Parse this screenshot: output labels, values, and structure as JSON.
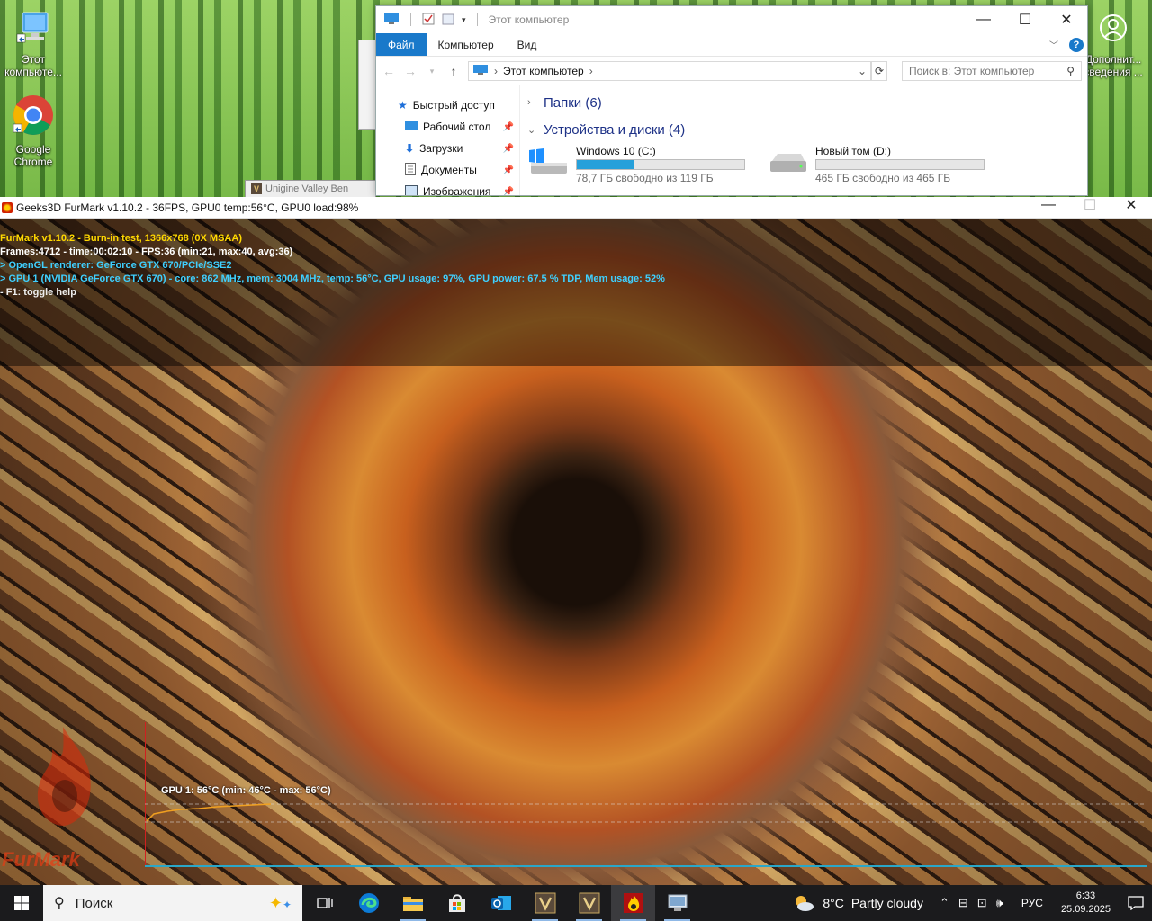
{
  "desktop": {
    "icons": [
      {
        "label": "Этот компьюте...",
        "icon": "computer-icon"
      },
      {
        "label": "Google Chrome",
        "icon": "chrome-icon"
      },
      {
        "label": "Дополнит... сведения ...",
        "icon": "user-icon"
      }
    ]
  },
  "behind_window": {
    "title": "Unigine Valley Ben"
  },
  "explorer": {
    "title": "Этот компьютер",
    "tabs": [
      "Файл",
      "Компьютер",
      "Вид"
    ],
    "active_tab": "Файл",
    "address": "Этот компьютер",
    "search_placeholder": "Поиск в: Этот компьютер",
    "nav": [
      {
        "label": "Быстрый доступ",
        "icon": "star-icon"
      },
      {
        "label": "Рабочий стол",
        "icon": "desktop-icon",
        "pinned": true
      },
      {
        "label": "Загрузки",
        "icon": "download-icon",
        "pinned": true
      },
      {
        "label": "Документы",
        "icon": "document-icon",
        "pinned": true
      },
      {
        "label": "Изображения",
        "icon": "image-icon",
        "pinned": true
      }
    ],
    "groups": [
      {
        "label": "Папки (6)",
        "expanded": false
      },
      {
        "label": "Устройства и диски (4)",
        "expanded": true
      }
    ],
    "drives": [
      {
        "name": "Windows 10 (C:)",
        "free": "78,7 ГБ свободно из 119 ГБ",
        "used_fraction": 0.34
      },
      {
        "name": "Новый том (D:)",
        "free": "465 ГБ свободно из 465 ГБ",
        "used_fraction": 0.0
      }
    ]
  },
  "furmark": {
    "title": "Geeks3D FurMark v1.10.2 - 36FPS, GPU0 temp:56°C, GPU0 load:98%",
    "hud": {
      "line1": "FurMark v1.10.2 - Burn-in test, 1366x768 (0X MSAA)",
      "line2": "Frames:4712 - time:00:02:10 - FPS:36 (min:21, max:40, avg:36)",
      "line3": "> OpenGL renderer: GeForce GTX 670/PCIe/SSE2",
      "line4": "> GPU 1 (NVIDIA GeForce GTX 670) - core: 862 MHz, mem: 3004 MHz, temp: 56°C, GPU usage: 97%, GPU power: 67.5 % TDP, Mem usage: 52%",
      "line5": "- F1: toggle help"
    },
    "graph_label": "GPU 1: 56°C (min: 46°C - max: 56°C)",
    "logo_text": "FurMark"
  },
  "taskbar": {
    "search_placeholder": "Поиск",
    "apps": [
      {
        "name": "task-view",
        "icon": "task-view-icon"
      },
      {
        "name": "edge",
        "icon": "edge-icon"
      },
      {
        "name": "file-explorer",
        "icon": "folder-icon",
        "open": true
      },
      {
        "name": "store",
        "icon": "store-icon"
      },
      {
        "name": "outlook",
        "icon": "outlook-icon"
      },
      {
        "name": "valley-1",
        "icon": "valley-icon",
        "open": true
      },
      {
        "name": "valley-2",
        "icon": "valley-icon",
        "open": true
      },
      {
        "name": "furmark",
        "icon": "furmark-icon",
        "open": true,
        "active": true
      },
      {
        "name": "control-panel",
        "icon": "control-panel-icon",
        "open": true
      }
    ],
    "weather": {
      "temp": "8°C",
      "condition": "Partly cloudy"
    },
    "language": "РУС",
    "time": "6:33",
    "date": "25.09.2025"
  }
}
